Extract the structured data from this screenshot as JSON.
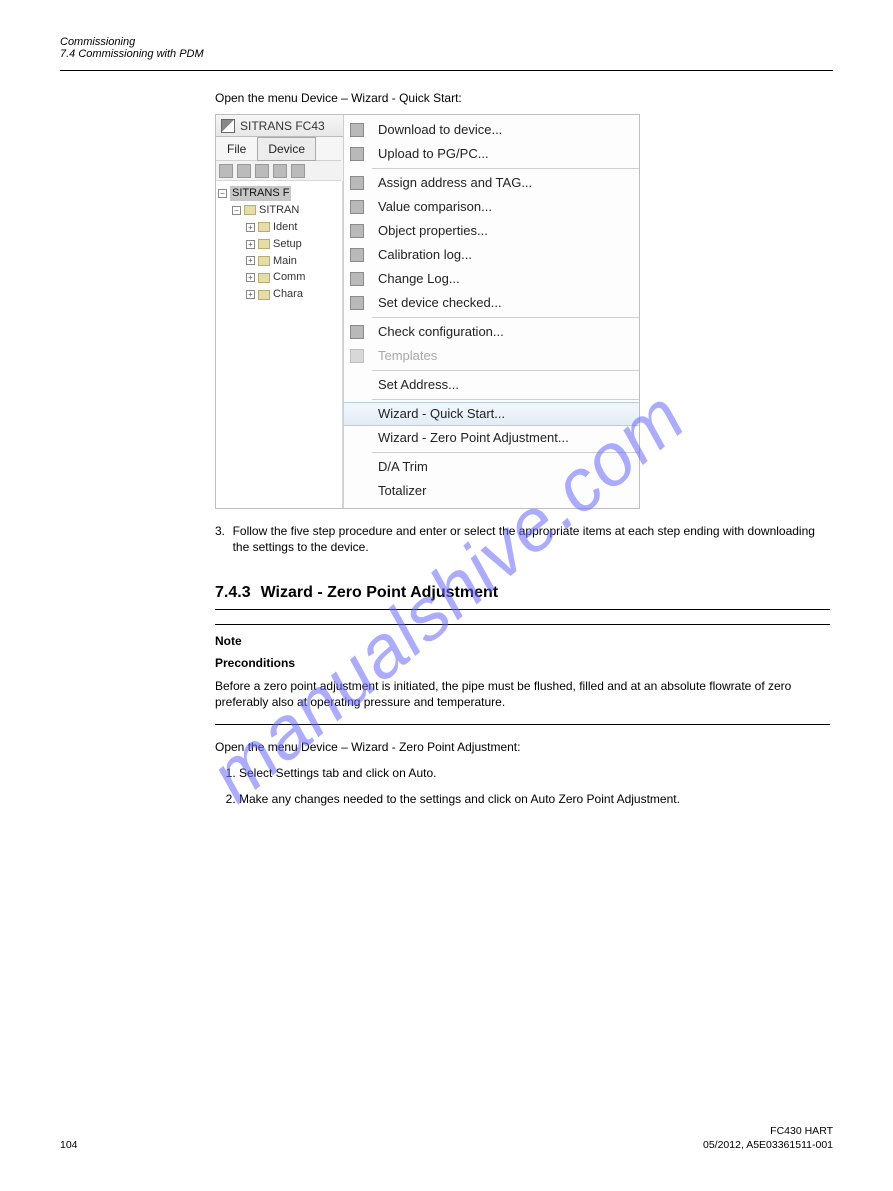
{
  "header": {
    "left_title": "Commissioning",
    "left_sub": "7.4 Commissioning with PDM",
    "right_title": "FC430 HART",
    "right_sub": "05/2012, A5E03361511-001"
  },
  "intro_text": "Open the menu Device – Wizard - Quick Start:",
  "screenshot": {
    "title": "SITRANS FC43",
    "menubar": {
      "file": "File",
      "device": "Device"
    },
    "tree": {
      "root": "SITRANS F",
      "child": "SITRAN",
      "items": [
        "Ident",
        "Setup",
        "Main",
        "Comm",
        "Chara"
      ]
    },
    "menu": {
      "items": [
        {
          "label": "Download to device...",
          "type": "item",
          "icon": true
        },
        {
          "label": "Upload to PG/PC...",
          "type": "item",
          "icon": true
        },
        {
          "type": "sep"
        },
        {
          "label": "Assign address and TAG...",
          "type": "item",
          "icon": true
        },
        {
          "label": "Value comparison...",
          "type": "item",
          "icon": true
        },
        {
          "label": "Object properties...",
          "type": "item",
          "icon": true
        },
        {
          "label": "Calibration log...",
          "type": "item",
          "icon": true
        },
        {
          "label": "Change Log...",
          "type": "item",
          "icon": true
        },
        {
          "label": "Set device checked...",
          "type": "item",
          "icon": true
        },
        {
          "type": "sep"
        },
        {
          "label": "Check configuration...",
          "type": "item",
          "icon": true
        },
        {
          "label": "Templates",
          "type": "item",
          "icon": true,
          "disabled": true
        },
        {
          "type": "sep"
        },
        {
          "label": "Set Address...",
          "type": "item",
          "icon": false
        },
        {
          "type": "sep"
        },
        {
          "label": "Wizard - Quick Start...",
          "type": "item",
          "icon": false,
          "selected": true
        },
        {
          "label": "Wizard - Zero Point Adjustment...",
          "type": "item",
          "icon": false
        },
        {
          "type": "sep"
        },
        {
          "label": "D/A Trim",
          "type": "item",
          "icon": false
        },
        {
          "label": "Totalizer",
          "type": "item",
          "icon": false
        }
      ]
    }
  },
  "step3": {
    "num": "3.",
    "text": "Follow the five step procedure and enter or select the appropriate items at each step ending with downloading the settings to the device."
  },
  "section": {
    "num": "7.4.3",
    "title": "Wizard - Zero Point Adjustment",
    "note_title": "Note",
    "note_sub": "Preconditions",
    "note_body": "Before a zero point adjustment is initiated, the pipe must be flushed, filled and at an absolute flowrate of zero preferably also at operating pressure and temperature.",
    "para1": "Open the menu Device – Wizard - Zero Point Adjustment:",
    "li1": "Select Settings tab and click on Auto.",
    "li2": "Make any changes needed to the settings and click on Auto Zero Point Adjustment."
  },
  "footer": {
    "left1": " ",
    "right1": " ",
    "left2_label": "104",
    "right2_label": " "
  },
  "watermark": "manualshive.com"
}
